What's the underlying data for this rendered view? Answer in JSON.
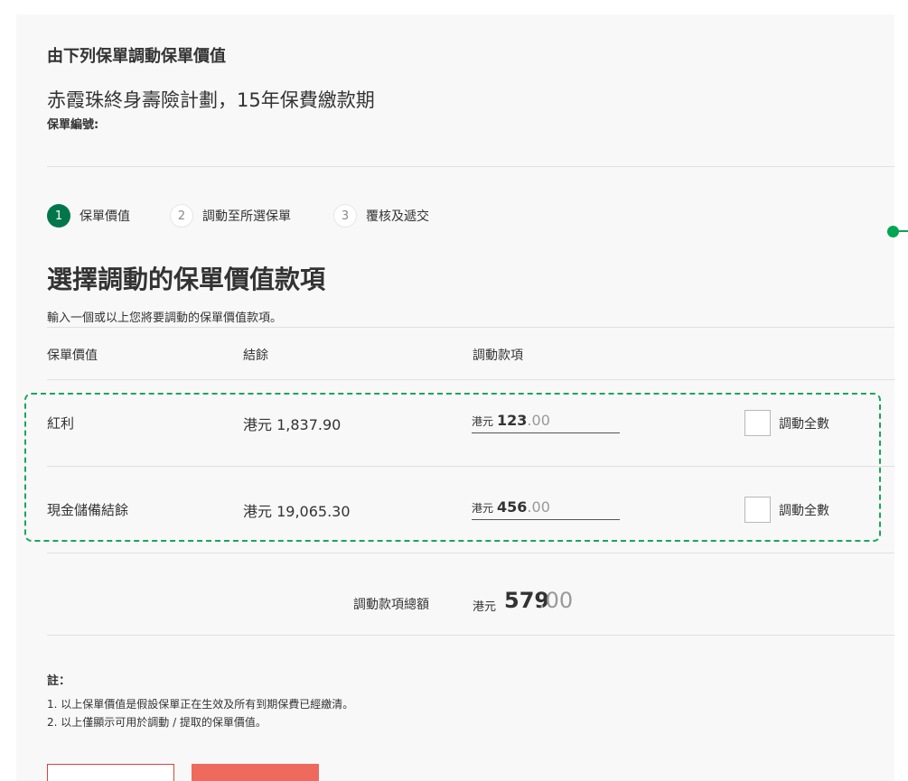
{
  "header": {
    "section_title": "由下列保單調動保單價值",
    "plan_name": "赤霞珠終身壽險計劃，15年保費繳款期",
    "policy_number_label": "保單編號:"
  },
  "steps": [
    {
      "number": "1",
      "label": "保單價值",
      "active": true
    },
    {
      "number": "2",
      "label": "調動至所選保單",
      "active": false
    },
    {
      "number": "3",
      "label": "覆核及遞交",
      "active": false
    }
  ],
  "main": {
    "heading": "選擇調動的保單價值款項",
    "subtext": "輸入一個或以上您將要調動的保單價值款項。"
  },
  "table": {
    "headers": [
      "保單價值",
      "結餘",
      "調動款項"
    ],
    "rows": [
      {
        "name": "紅利",
        "balance": "港元 1,837.90",
        "amount_currency": "港元",
        "amount_int": "123",
        "amount_dec": ".00",
        "checkbox_label": "調動全數",
        "checked": false
      },
      {
        "name": "現金儲備結餘",
        "balance": "港元 19,065.30",
        "amount_currency": "港元",
        "amount_int": "456",
        "amount_dec": ".00",
        "checkbox_label": "調動全數",
        "checked": false
      }
    ]
  },
  "total": {
    "label": "調動款項總額",
    "currency": "港元",
    "amount_int": "579",
    "amount_dec": ".00"
  },
  "notes": {
    "title": "註：",
    "items": [
      "1. 以上保單價值是假設保單正在生效及所有到期保費已經繳清。",
      "2. 以上僅顯示可用於調動 / 提取的保單價值。"
    ]
  },
  "colors": {
    "accent_green": "#00764a",
    "highlight_green": "#1aa65a",
    "button_red": "#ee6a5e"
  }
}
